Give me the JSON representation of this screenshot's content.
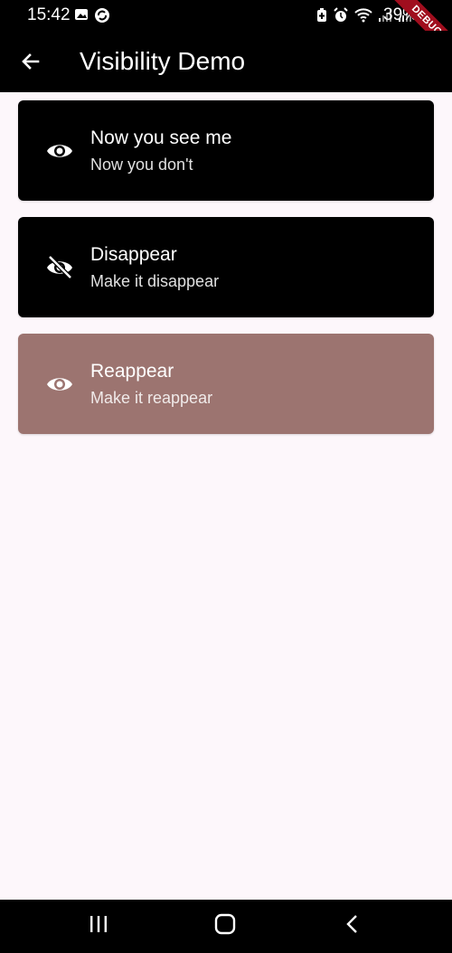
{
  "status": {
    "time": "15:42",
    "battery": "39%",
    "debug_badge": "DEBUG",
    "left_icons": [
      "image-icon",
      "sync-icon"
    ],
    "right_icons": [
      "battery-saver-icon",
      "alarm-icon",
      "wifi-icon",
      "signal-icon",
      "signal-icon"
    ]
  },
  "app_bar": {
    "title": "Visibility Demo",
    "back_icon": "arrow-back-icon"
  },
  "cards": [
    {
      "title": "Now you see me",
      "subtitle": "Now you don't",
      "icon": "eye-icon",
      "state": "visible"
    },
    {
      "title": "Disappear",
      "subtitle": "Make it disappear",
      "icon": "eye-off-icon",
      "state": "visible"
    },
    {
      "title": "Reappear",
      "subtitle": "Make it reappear",
      "icon": "eye-icon",
      "state": "faded"
    }
  ],
  "nav_bar": {
    "items": [
      "recents-icon",
      "home-icon",
      "back-icon"
    ]
  },
  "colors": {
    "app_bar": "#000000",
    "card": "#000000",
    "card_faded": "#9c7470",
    "background": "#fdf7fb",
    "debug_ribbon": "#a00e1e"
  }
}
